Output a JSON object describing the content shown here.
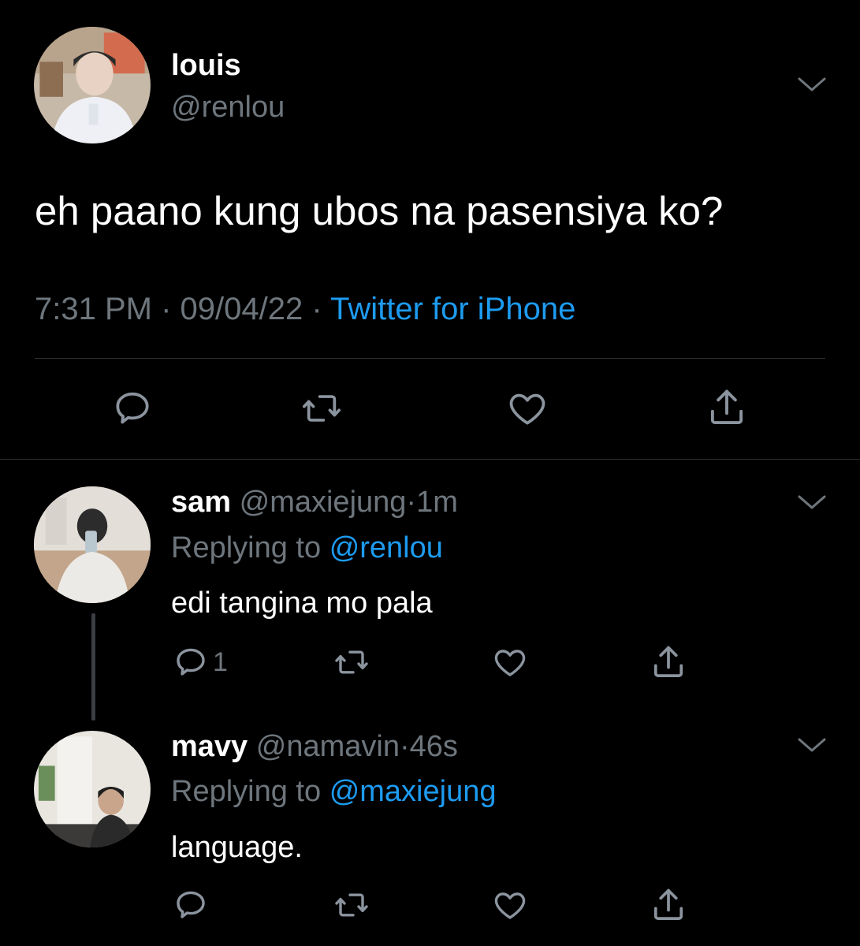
{
  "main_tweet": {
    "display_name": "louis",
    "handle": "@renlou",
    "text": "eh paano kung ubos na pasensiya ko?",
    "time": "7:31 PM",
    "separator": "·",
    "date": "09/04/22",
    "source": "Twitter for iPhone"
  },
  "replies": [
    {
      "display_name": "sam",
      "handle": "@maxiejung",
      "separator": "·",
      "time": "1m",
      "replying_prefix": "Replying to",
      "replying_to": "@renlou",
      "text": "edi tangina mo pala",
      "reply_count": "1"
    },
    {
      "display_name": "mavy",
      "handle": "@namavin",
      "separator": "·",
      "time": "46s",
      "replying_prefix": "Replying to",
      "replying_to": "@maxiejung",
      "text": "language.",
      "reply_count": ""
    }
  ],
  "icons": {
    "reply": "speech-bubble-icon",
    "retweet": "retweet-icon",
    "like": "heart-icon",
    "share": "share-icon",
    "menu": "chevron-down-icon"
  },
  "colors": {
    "background": "#000000",
    "text": "#ffffff",
    "muted": "#6e767d",
    "link": "#1d9bf0",
    "divider": "#2f3336"
  }
}
